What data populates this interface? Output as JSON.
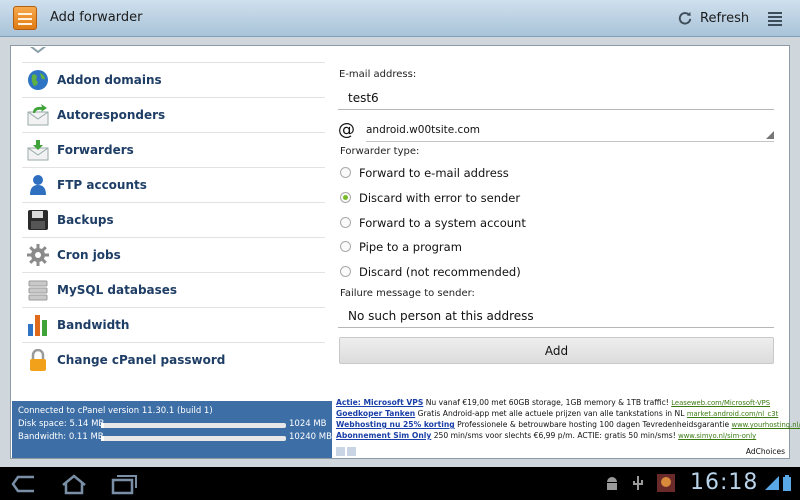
{
  "header": {
    "title": "Add forwarder",
    "refresh_label": "Refresh",
    "colors": {
      "bar": "#b8d0e3",
      "accent": "#e07a14"
    }
  },
  "sidebar": {
    "items": [
      {
        "label": "Addon domains",
        "icon": "globe-icon"
      },
      {
        "label": "Autoresponders",
        "icon": "autoresponder-icon"
      },
      {
        "label": "Forwarders",
        "icon": "forwarder-icon"
      },
      {
        "label": "FTP accounts",
        "icon": "user-icon"
      },
      {
        "label": "Backups",
        "icon": "floppy-disk-icon"
      },
      {
        "label": "Cron jobs",
        "icon": "gear-icon"
      },
      {
        "label": "MySQL databases",
        "icon": "database-icon"
      },
      {
        "label": "Bandwidth",
        "icon": "bar-chart-icon"
      },
      {
        "label": "Change cPanel password",
        "icon": "lock-icon"
      }
    ]
  },
  "form": {
    "email_label": "E-mail address:",
    "email_value": "test6",
    "at_symbol": "@",
    "domain_value": "android.w00tsite.com",
    "type_label": "Forwarder type:",
    "options": [
      {
        "label": "Forward to e-mail address",
        "selected": false
      },
      {
        "label": "Discard with error to sender",
        "selected": true
      },
      {
        "label": "Forward to a system account",
        "selected": false
      },
      {
        "label": "Pipe to a program",
        "selected": false
      },
      {
        "label": "Discard (not recommended)",
        "selected": false
      }
    ],
    "failure_label": "Failure message to sender:",
    "failure_value": "No such person at this address",
    "add_label": "Add"
  },
  "status": {
    "connected": "Connected to cPanel version 11.30.1 (build 1)",
    "disk_label": "Disk space: 5.14 MB",
    "disk_max": "1024 MB",
    "disk_fraction": 0.005,
    "bandwidth_label": "Bandwidth: 0.11 MB",
    "bandwidth_max": "10240 MB",
    "bandwidth_fraction": 0.0001
  },
  "ads": [
    {
      "title": "Actie: Microsoft VPS",
      "text": "Nu vanaf €19,00 met 60GB storage, 1GB memory & 1TB traffic!",
      "url": "Leaseweb.com/Microsoft-VPS"
    },
    {
      "title": "Goedkoper Tanken",
      "text": "Gratis Android-app met alle actuele prijzen van alle tankstations in NL",
      "url": "market.android.com/nl_c3t"
    },
    {
      "title": "Webhosting nu 25% korting",
      "text": "Professionele & betrouwbare hosting 100 dagen Tevredenheidsgarantie",
      "url": "www.yourhosting.nl/hosting"
    },
    {
      "title": "Abonnement Sim Only",
      "text": "250 min/sms voor slechts €6,99 p/m. ACTIE: gratis 50 min/sms!",
      "url": "www.simyo.nl/sim-only"
    }
  ],
  "ad_choices": "AdChoices",
  "system_bar": {
    "clock": "16:18"
  }
}
